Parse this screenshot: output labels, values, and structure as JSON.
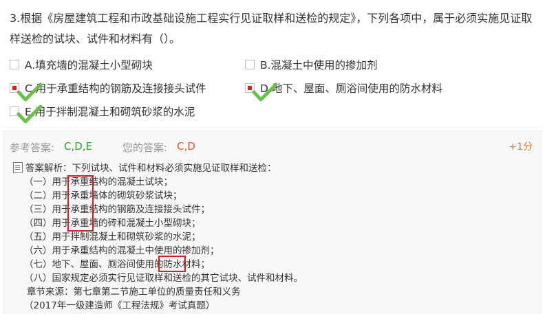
{
  "question": {
    "text": "3.根据《房屋建筑工程和市政基础设施工程实行见证取样和送检的规定》，下列各项中，属于必须实施见证取样送检的试块、试件和材料有（）。"
  },
  "options": [
    {
      "label": "A.填充墙的混凝土小型砌块",
      "checked": false,
      "correct": false
    },
    {
      "label": "B.混凝土中使用的掺加剂",
      "checked": false,
      "correct": false
    },
    {
      "label": "C.用于承重结构的钢筋及连接接头试件",
      "checked": true,
      "correct": true
    },
    {
      "label": "D.地下、屋面、厕浴间使用的防水材料",
      "checked": true,
      "correct": true
    },
    {
      "label": "E.用于拌制混凝土和砌筑砂浆的水泥",
      "checked": false,
      "correct": true
    }
  ],
  "answer_panel": {
    "ref_label": "参考答案:",
    "ref_value": "C,D,E",
    "your_label": "您的答案:",
    "your_value": "C,D",
    "score": "+1分"
  },
  "analysis": {
    "heading": "答案解析：下列试块、试件和材料必须实施见证取样和送检：",
    "items": [
      "（一）用于承重结构的混凝土试块；",
      "（二）用于承重墙体的砌筑砂浆试块；",
      "（三）用于承重结构的钢筋及连接接头试件；",
      "（四）用于承重墙的砖和混凝土小型砌块；",
      "（五）用于拌制混凝土和砌筑砂浆的水泥；",
      "（六）用于承重结构的混凝土中使用的掺加剂；",
      "（七）地下、屋面、厕浴间使用的防水材料；",
      "（八）国家规定必须实行见证取样和送检的其它试块、试件和材料。"
    ],
    "chapter": "章节来源：第七章第二节施工单位的质量责任和义务",
    "source": "（2017年一级建造师《工程法规》考试真题）"
  },
  "colors": {
    "correct_green": "#2aa52a",
    "wrong_red": "#e05a2a",
    "check_red": "#e02020",
    "highlight_red": "#d42020"
  }
}
